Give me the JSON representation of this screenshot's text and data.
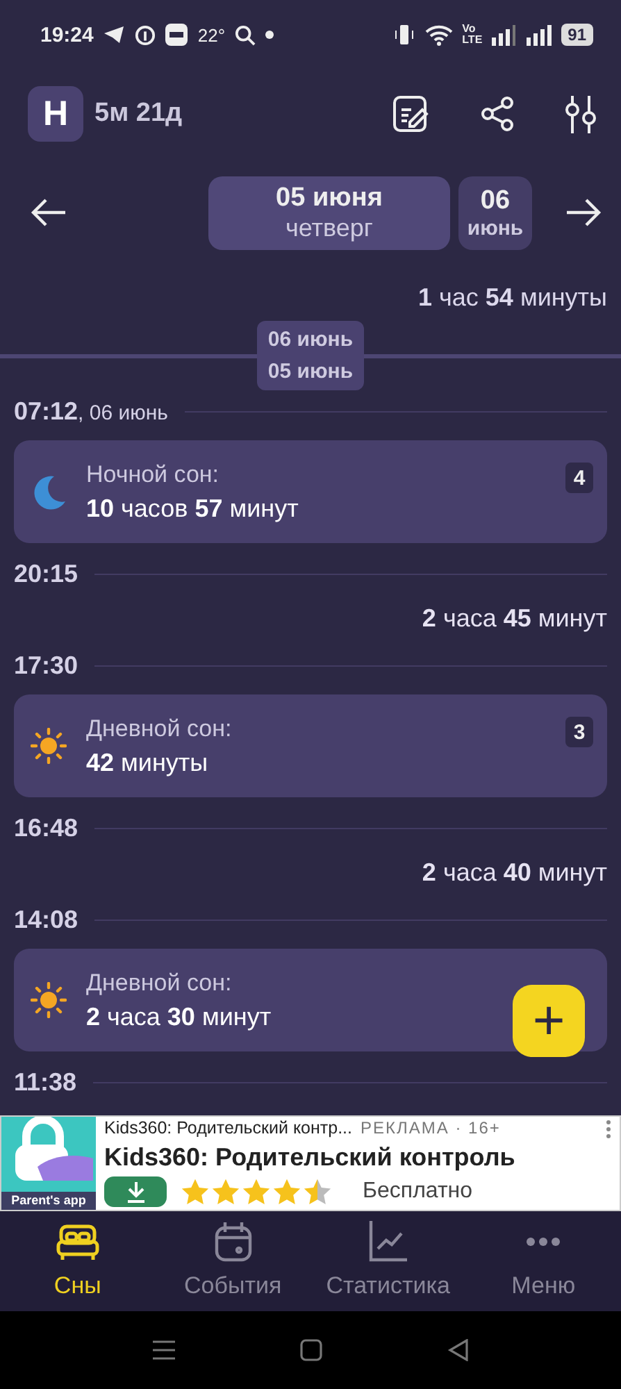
{
  "status_bar": {
    "time": "19:24",
    "temperature": "22°",
    "lte": "Vo LTE",
    "battery": "91"
  },
  "header": {
    "avatar": "Н",
    "age": "5м 21д"
  },
  "date_nav": {
    "days": [
      {
        "date": "05 июня",
        "weekday": "четверг",
        "selected": true
      },
      {
        "date": "06",
        "weekday": "июнь",
        "selected": false
      }
    ]
  },
  "day_total": "**1** час **54** минуты",
  "date_chip": {
    "top": "06 июнь",
    "bottom": "05 июнь"
  },
  "timeline": [
    {
      "kind": "time",
      "time": "07:12",
      "note": ", 06 июнь"
    },
    {
      "kind": "sleep",
      "night": true,
      "title": "Ночной сон:",
      "duration": "**10** часов **57** минут",
      "count": "4"
    },
    {
      "kind": "time",
      "time": "20:15"
    },
    {
      "kind": "gap",
      "text": "**2** часа **45** минут"
    },
    {
      "kind": "time",
      "time": "17:30"
    },
    {
      "kind": "sleep",
      "night": false,
      "title": "Дневной сон:",
      "duration": "**42** минуты",
      "count": "3"
    },
    {
      "kind": "time",
      "time": "16:48"
    },
    {
      "kind": "gap",
      "text": "**2** часа **40** минут"
    },
    {
      "kind": "time",
      "time": "14:08"
    },
    {
      "kind": "sleep",
      "night": false,
      "title": "Дневной сон:",
      "duration": "**2** часа **30** минут"
    },
    {
      "kind": "time",
      "time": "11:38"
    }
  ],
  "fab": "+",
  "ad": {
    "icon_caption": "Parent's app",
    "headline": "Kids360: Родительский контр...",
    "label": "РЕКЛАМА · 16+",
    "title": "Kids360: Родительский контроль",
    "stars": 4.5,
    "price": "Бесплатно"
  },
  "bottom_nav": [
    {
      "label": "Сны",
      "selected": true
    },
    {
      "label": "События",
      "selected": false
    },
    {
      "label": "Статистика",
      "selected": false
    },
    {
      "label": "Меню",
      "selected": false
    }
  ]
}
